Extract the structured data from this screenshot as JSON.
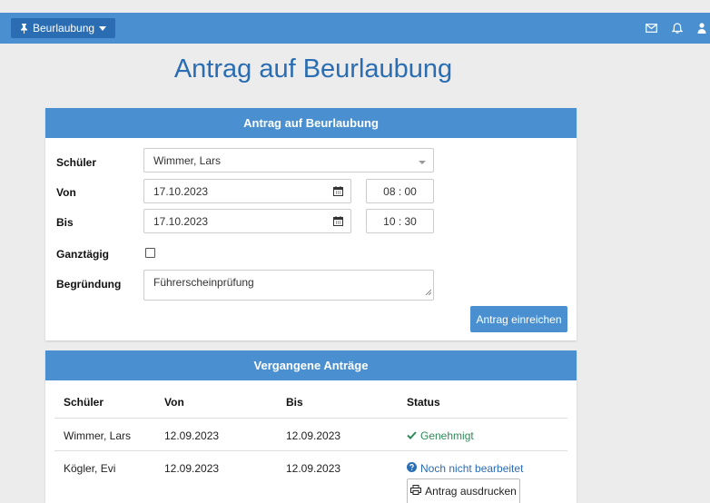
{
  "nav": {
    "menu_label": "Beurlaubung",
    "menu_icon": "pin-icon",
    "right_icons": [
      "mail-icon",
      "bell-icon",
      "user-icon"
    ]
  },
  "page": {
    "title": "Antrag auf Beurlaubung"
  },
  "form": {
    "header": "Antrag auf Beurlaubung",
    "schueler_label": "Schüler",
    "schueler_value": "Wimmer, Lars",
    "von_label": "Von",
    "von_date": "17.10.2023",
    "von_time": "08 : 00",
    "bis_label": "Bis",
    "bis_date": "17.10.2023",
    "bis_time": "10 : 30",
    "ganztaegig_label": "Ganztägig",
    "ganztaegig_checked": false,
    "begruendung_label": "Begründung",
    "begruendung_value": "Führerscheinprüfung",
    "submit_label": "Antrag einreichen"
  },
  "history": {
    "header": "Vergangene Anträge",
    "columns": [
      "Schüler",
      "Von",
      "Bis",
      "Status"
    ],
    "rows": [
      {
        "schueler": "Wimmer, Lars",
        "von": "12.09.2023",
        "bis": "12.09.2023",
        "status": "Genehmigt"
      },
      {
        "schueler": "Kögler, Evi",
        "von": "12.09.2023",
        "bis": "12.09.2023",
        "status": "Noch nicht bearbeitet"
      }
    ],
    "print_label": "Antrag ausdrucken"
  },
  "colors": {
    "primary": "#4a90d0",
    "dark_primary": "#2a6db3",
    "success": "#2e8b57"
  }
}
